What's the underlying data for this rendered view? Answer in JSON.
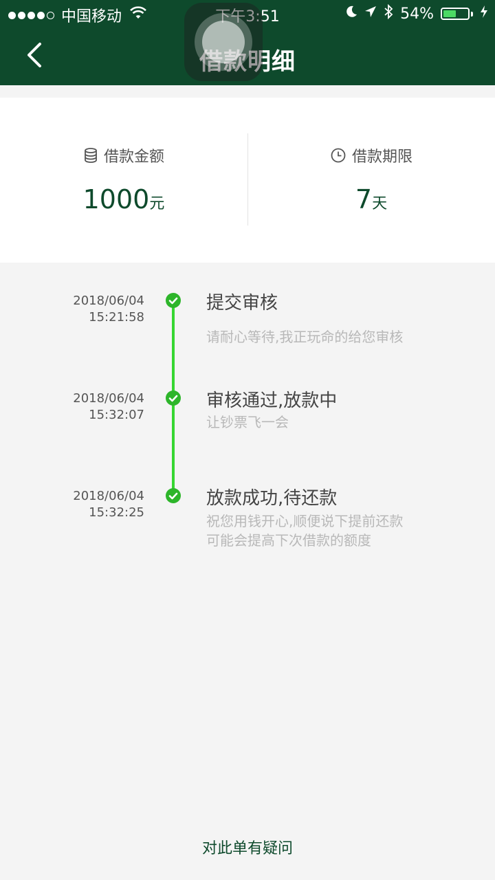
{
  "status_bar": {
    "carrier": "中国移动",
    "time": "下午3:51",
    "battery_percent": "54%",
    "battery_level": 0.54,
    "signal_bars": 4
  },
  "nav": {
    "back_icon": "chevron-left-icon",
    "title": "借款明细"
  },
  "summary": {
    "amount": {
      "label": "借款金额",
      "icon": "coin-stack-icon",
      "value": "1000",
      "unit": "元"
    },
    "term": {
      "label": "借款期限",
      "icon": "clock-icon",
      "value": "7",
      "unit": "天"
    }
  },
  "timeline": [
    {
      "date": "2018/06/04",
      "time": "15:21:58",
      "title": "提交审核",
      "desc": [
        "请耐心等待,我正玩命的给您审核"
      ]
    },
    {
      "date": "2018/06/04",
      "time": "15:32:07",
      "title": "审核通过,放款中",
      "desc": [
        "让钞票飞一会"
      ]
    },
    {
      "date": "2018/06/04",
      "time": "15:32:25",
      "title": "放款成功,待还款",
      "desc": [
        "祝您用钱开心,顺便说下提前还款",
        "可能会提高下次借款的额度"
      ]
    }
  ],
  "footer": {
    "question_link": "对此单有疑问"
  },
  "colors": {
    "header": "#0e4a2c",
    "accent_green": "#37d632",
    "check_green": "#2db52a"
  }
}
